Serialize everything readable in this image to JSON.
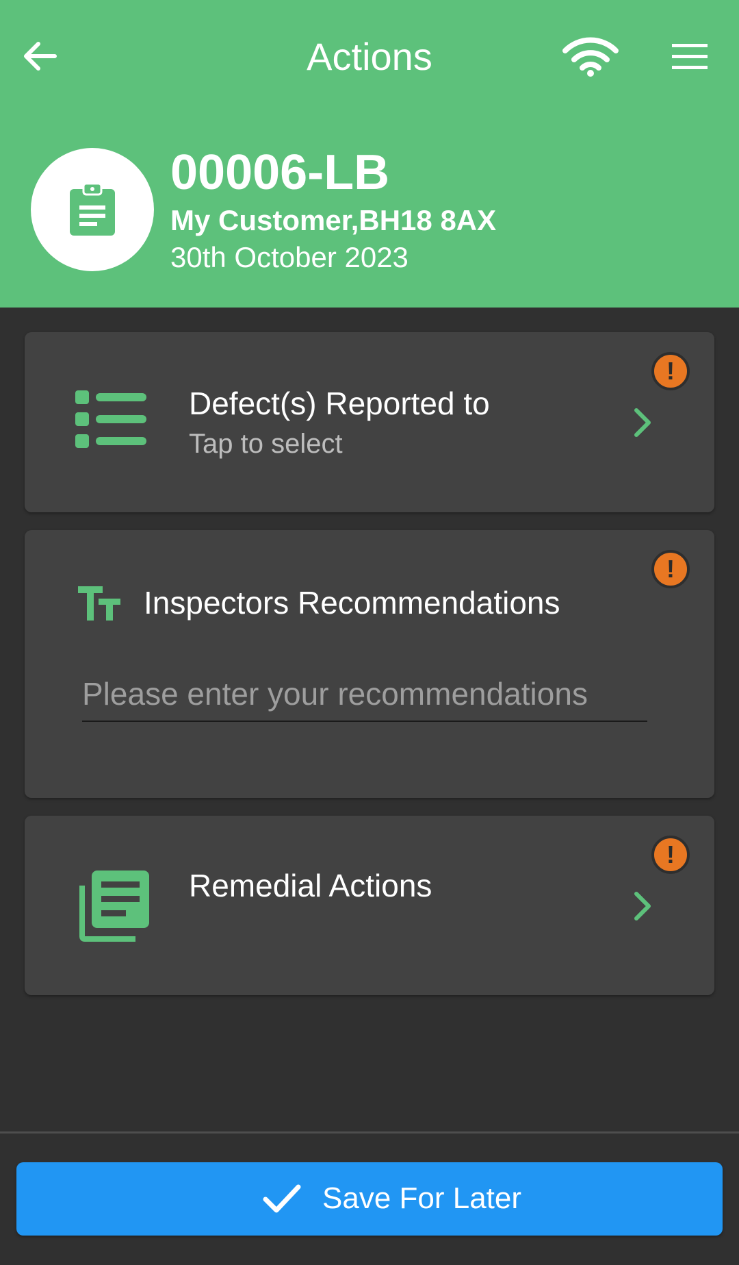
{
  "header": {
    "title": "Actions",
    "back_icon": "arrow-left-icon",
    "wifi_icon": "wifi-icon",
    "menu_icon": "hamburger-menu-icon"
  },
  "job": {
    "icon": "clipboard-icon",
    "id": "00006-LB",
    "customer": "My Customer,BH18 8AX",
    "date": "30th October 2023"
  },
  "cards": {
    "defects": {
      "icon": "list-icon",
      "title": "Defect(s) Reported to",
      "subtitle": "Tap to select",
      "status_icon": "exclamation-alert-icon"
    },
    "recommendations": {
      "icon": "text-size-icon",
      "title": "Inspectors Recommendations",
      "placeholder": "Please enter your recommendations",
      "value": "",
      "status_icon": "exclamation-alert-icon"
    },
    "remedial": {
      "icon": "library-books-icon",
      "title": "Remedial Actions",
      "status_icon": "exclamation-alert-icon"
    }
  },
  "footer": {
    "save_label": "Save For Later",
    "save_icon": "checkmark-icon"
  },
  "colors": {
    "header_bg": "#5dc17b",
    "page_bg": "#303030",
    "card_bg": "#424242",
    "accent_green": "#5dc17b",
    "alert_orange": "#e87722",
    "button_blue": "#2196f3"
  },
  "warn_symbol": "!"
}
